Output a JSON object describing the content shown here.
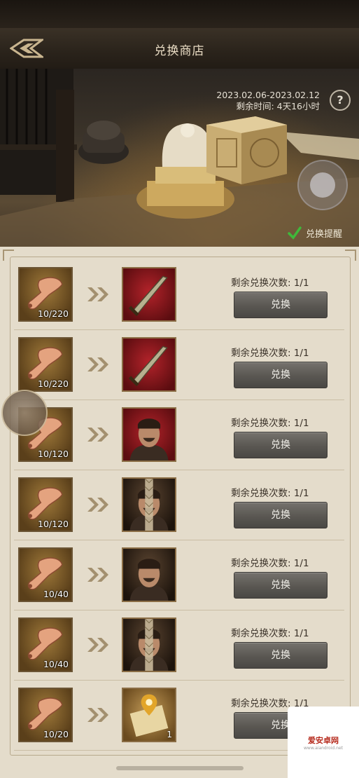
{
  "header": {
    "title": "兑换商店"
  },
  "banner": {
    "date_range": "2023.02.06-2023.02.12",
    "remaining": "剩余时间:  4天16小时",
    "help_label": "?",
    "reminder_label": "兑换提醒"
  },
  "rows": [
    {
      "cost_count": "10/220",
      "reward_type": "sword",
      "remain": "剩余兑换次数:  1/1",
      "button": "兑换"
    },
    {
      "cost_count": "10/220",
      "reward_type": "sword",
      "remain": "剩余兑换次数:  1/1",
      "button": "兑换"
    },
    {
      "cost_count": "10/120",
      "reward_type": "general",
      "remain": "剩余兑换次数:  1/1",
      "button": "兑换"
    },
    {
      "cost_count": "10/120",
      "reward_type": "general-fragment",
      "remain": "剩余兑换次数:  1/1",
      "button": "兑换"
    },
    {
      "cost_count": "10/40",
      "reward_type": "general",
      "remain": "剩余兑换次数:  1/1",
      "button": "兑换"
    },
    {
      "cost_count": "10/40",
      "reward_type": "general-fragment",
      "remain": "剩余兑换次数:  1/1",
      "button": "兑换"
    },
    {
      "cost_count": "10/20",
      "reward_type": "map-scroll",
      "reward_count": "1",
      "remain": "剩余兑换次数:  1/1",
      "button": "兑换"
    }
  ],
  "watermark": {
    "text": "爱安卓网",
    "sub": "www.aiandroid.net"
  },
  "colors": {
    "accent": "#e9dcc4",
    "button": "#5a5752",
    "panel": "#e4dccb"
  }
}
